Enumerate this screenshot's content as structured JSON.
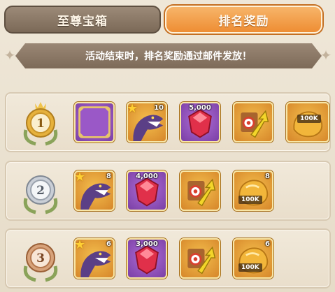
{
  "tabs": {
    "left_label": "至尊宝箱",
    "right_label": "排名奖励"
  },
  "notice": "活动结束时，排名奖励通过邮件发放！",
  "ranks": [
    {
      "rank": "1",
      "medal": "gold-medal",
      "items": [
        {
          "icon": "empty-frame-icon",
          "qty": ""
        },
        {
          "icon": "dinosaur-icon",
          "qty": "10"
        },
        {
          "icon": "red-gem-icon",
          "qty": "5,000"
        },
        {
          "icon": "speed-boost-icon",
          "qty": ""
        },
        {
          "icon": "gold-ore-icon",
          "tag": "100K"
        }
      ]
    },
    {
      "rank": "2",
      "medal": "silver-medal",
      "items": [
        {
          "icon": "dinosaur-icon",
          "qty": "8"
        },
        {
          "icon": "red-gem-icon",
          "qty": "4,000"
        },
        {
          "icon": "speed-boost-icon",
          "qty": ""
        },
        {
          "icon": "gold-ore-icon",
          "qty": "8",
          "tag": "100K"
        }
      ]
    },
    {
      "rank": "3",
      "medal": "bronze-medal",
      "items": [
        {
          "icon": "dinosaur-icon",
          "qty": "6"
        },
        {
          "icon": "red-gem-icon",
          "qty": "3,000"
        },
        {
          "icon": "speed-boost-icon",
          "qty": ""
        },
        {
          "icon": "gold-ore-icon",
          "qty": "6",
          "tag": "100K"
        }
      ]
    }
  ],
  "colors": {
    "active_tab": "#ee8d33",
    "inactive_tab": "#7b6957",
    "purple_tile": "#7a3fa5",
    "orange_tile": "#d6862a"
  }
}
